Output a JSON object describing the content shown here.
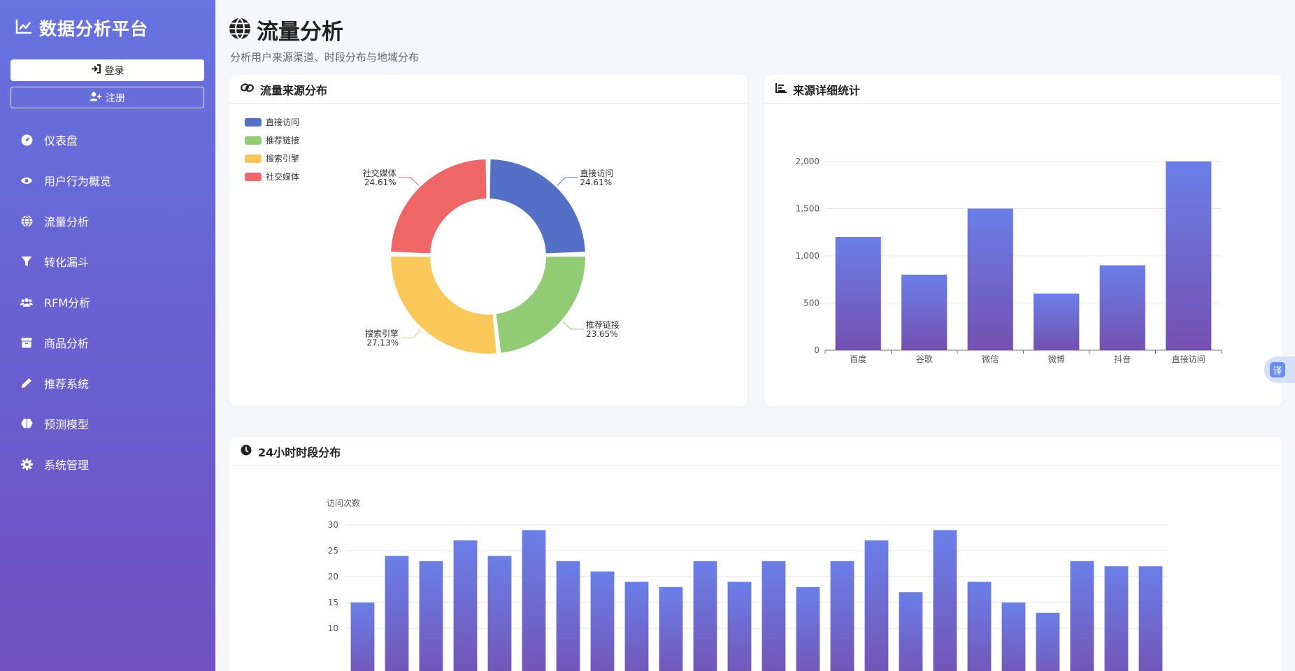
{
  "app": {
    "title": "数据分析平台"
  },
  "auth": {
    "login_label": "登录",
    "register_label": "注册"
  },
  "sidebar": {
    "items": [
      {
        "label": "仪表盘",
        "icon": "dashboard-icon"
      },
      {
        "label": "用户行为概览",
        "icon": "eye-icon"
      },
      {
        "label": "流量分析",
        "icon": "globe-icon"
      },
      {
        "label": "转化漏斗",
        "icon": "funnel-icon"
      },
      {
        "label": "RFM分析",
        "icon": "users-icon"
      },
      {
        "label": "商品分析",
        "icon": "box-icon"
      },
      {
        "label": "推荐系统",
        "icon": "pencil-icon"
      },
      {
        "label": "预测模型",
        "icon": "brain-icon"
      },
      {
        "label": "系统管理",
        "icon": "gear-icon"
      }
    ]
  },
  "page": {
    "title": "流量分析",
    "subtitle": "分析用户来源渠道、时段分布与地域分布"
  },
  "cards": {
    "source_pie": {
      "title": "流量来源分布"
    },
    "source_bar": {
      "title": "来源详细统计"
    },
    "hourly": {
      "title": "24小时时段分布"
    }
  },
  "translate": {
    "label": "译"
  },
  "colors": {
    "accent": "#6673e0",
    "bar_top": "#6a7fe8",
    "bar_bottom": "#7450b0"
  },
  "chart_data": [
    {
      "type": "pie",
      "variant": "donut",
      "categories": [
        "直接访问",
        "推荐链接",
        "搜索引擎",
        "社交媒体"
      ],
      "values": [
        24.61,
        23.65,
        27.13,
        24.61
      ],
      "labels": [
        "24.61%",
        "23.65%",
        "27.13%",
        "24.61%"
      ],
      "colors": [
        "#5470c6",
        "#91cc75",
        "#fac858",
        "#ee6666"
      ],
      "legend": "top-left"
    },
    {
      "type": "bar",
      "categories": [
        "百度",
        "谷歌",
        "微信",
        "微博",
        "抖音",
        "直接访问"
      ],
      "values": [
        1200,
        800,
        1500,
        600,
        900,
        2000
      ],
      "ylim": [
        0,
        2000
      ],
      "yticks": [
        "0",
        "500",
        "1,000",
        "1,500",
        "2,000"
      ],
      "grid": true
    },
    {
      "type": "bar",
      "ylabel": "访问次数",
      "values": [
        15,
        24,
        23,
        27,
        24,
        29,
        23,
        21,
        19,
        18,
        23,
        19,
        23,
        18,
        23,
        27,
        17,
        29,
        19,
        15,
        13,
        23,
        22,
        22
      ],
      "yticks": [
        "10",
        "15",
        "20",
        "25",
        "30"
      ],
      "ylim": [
        0,
        30
      ],
      "grid": true
    }
  ]
}
